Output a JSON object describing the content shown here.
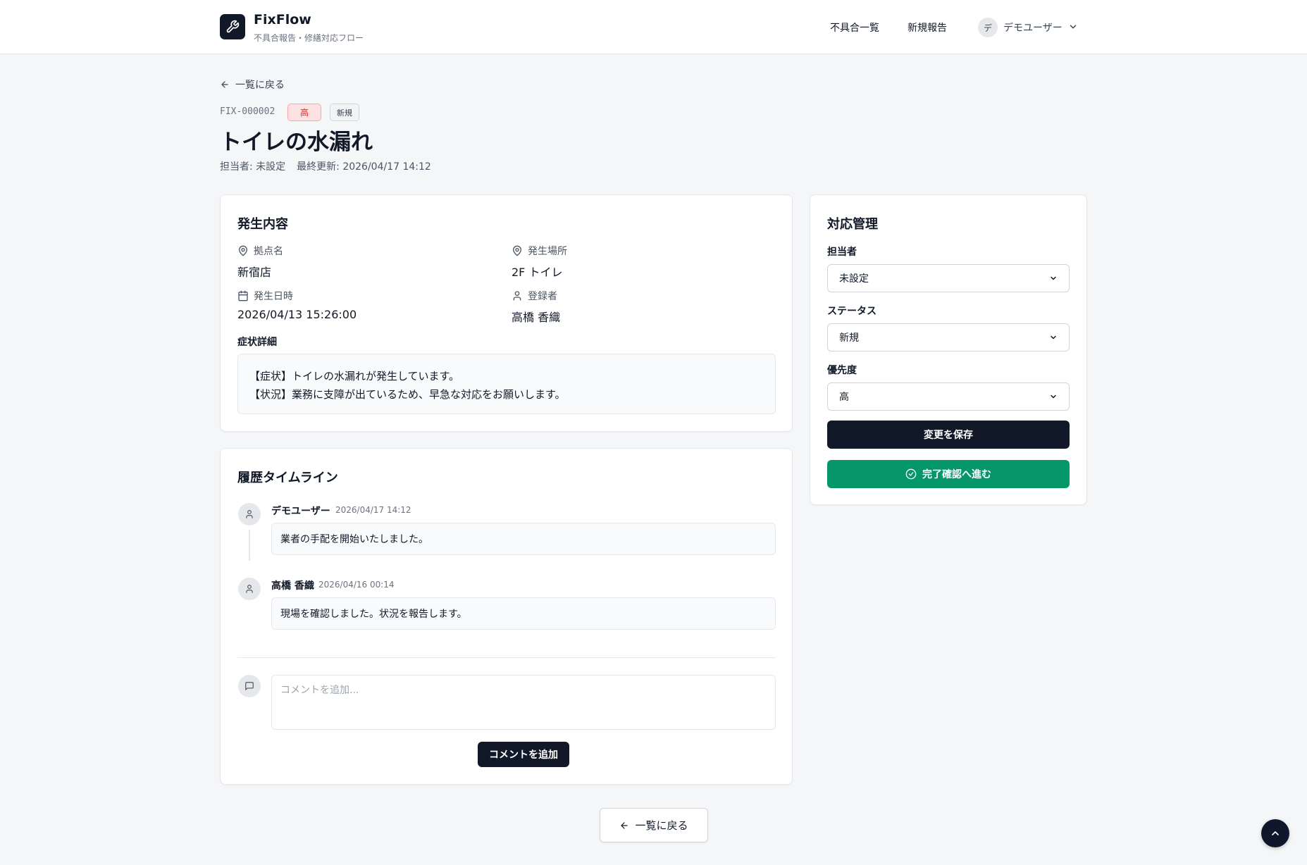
{
  "header": {
    "app_name": "FixFlow",
    "app_subtitle": "不具合報告・修繕対応フロー",
    "logo_icon": "wrench-icon",
    "nav": [
      {
        "label": "不具合一覧"
      },
      {
        "label": "新規報告"
      }
    ],
    "user": {
      "initial": "デ",
      "name": "デモユーザー"
    }
  },
  "back_link": "一覧に戻る",
  "ticket": {
    "id": "FIX-000002",
    "priority_badge": "高",
    "status_badge": "新規",
    "title": "トイレの水漏れ",
    "assignee_meta": "担当者: 未設定",
    "updated_meta": "最終更新: 2026/04/17 14:12"
  },
  "details": {
    "title": "発生内容",
    "fields": [
      {
        "label": "拠点名",
        "value": "新宿店",
        "icon": "map-pin-icon"
      },
      {
        "label": "発生場所",
        "value": "2F トイレ",
        "icon": "map-pin-icon"
      },
      {
        "label": "発生日時",
        "value": "2026/04/13 15:26:00",
        "icon": "calendar-icon"
      },
      {
        "label": "登録者",
        "value": "高橋 香織",
        "icon": "user-icon"
      }
    ],
    "symptom_label": "症状詳細",
    "symptom_lines": [
      "【症状】トイレの水漏れが発生しています。",
      "【状況】業務に支障が出ているため、早急な対応をお願いします。"
    ]
  },
  "timeline": {
    "title": "履歴タイムライン",
    "entries": [
      {
        "author": "デモユーザー",
        "time": "2026/04/17 14:12",
        "message": "業者の手配を開始いたしました。"
      },
      {
        "author": "高橋 香織",
        "time": "2026/04/16 00:14",
        "message": "現場を確認しました。状況を報告します。"
      }
    ],
    "comment_placeholder": "コメントを追加...",
    "comment_button": "コメントを追加"
  },
  "management": {
    "title": "対応管理",
    "assignee_label": "担当者",
    "assignee_value": "未設定",
    "status_label": "ステータス",
    "status_value": "新規",
    "priority_label": "優先度",
    "priority_value": "高",
    "save_button": "変更を保存",
    "complete_button": "完了確認へ進む"
  },
  "bottom_back": "一覧に戻る",
  "colors": {
    "primary_dark": "#111827",
    "success_green": "#059669",
    "priority_high_bg": "#fee2e2",
    "priority_high_text": "#dc2626"
  }
}
